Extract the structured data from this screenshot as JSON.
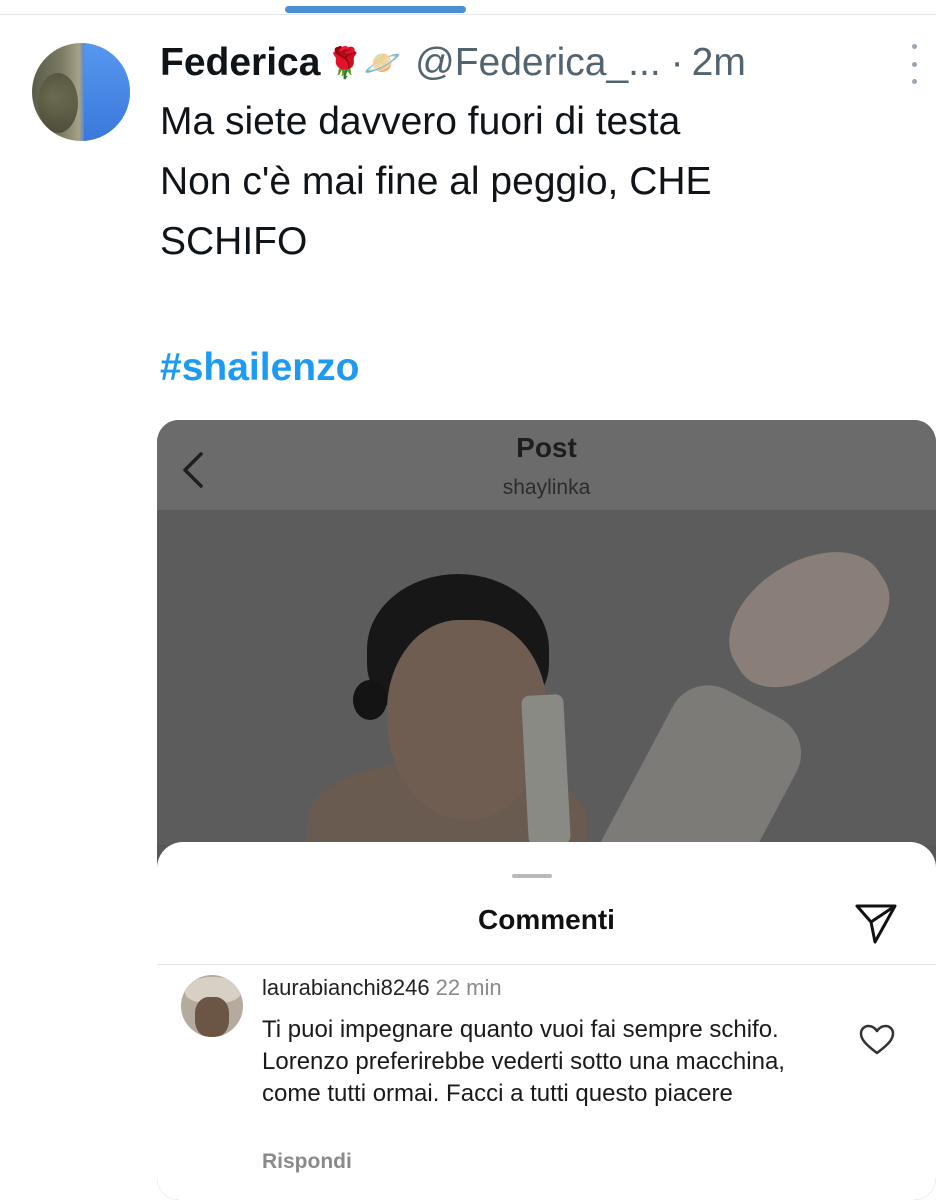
{
  "tweet": {
    "name": "Federica",
    "emojis": "🌹🪐",
    "handle": "@Federica_...",
    "separator": "·",
    "time": "2m",
    "lines": [
      "Ma siete davvero fuori di testa",
      "Non c'è mai fine al peggio, CHE",
      "SCHIFO"
    ],
    "hashtag": "#shailenzo"
  },
  "embed": {
    "title": "Post",
    "username": "shaylinka",
    "sheet": {
      "title": "Commenti",
      "comment": {
        "user": "laurabianchi8246",
        "time": "22 min",
        "text": "Ti puoi impegnare quanto vuoi fai sempre schifo. Lorenzo preferirebbe vederti sotto una macchina, come tutti ormai. Facci a tutti questo piacere",
        "reply_label": "Rispondi"
      }
    }
  },
  "icons": [
    "more-vertical-icon",
    "back-chevron-icon",
    "send-icon",
    "heart-icon"
  ],
  "colors": {
    "hashtag": "#1d9bf0",
    "secondary_text": "#536471"
  }
}
